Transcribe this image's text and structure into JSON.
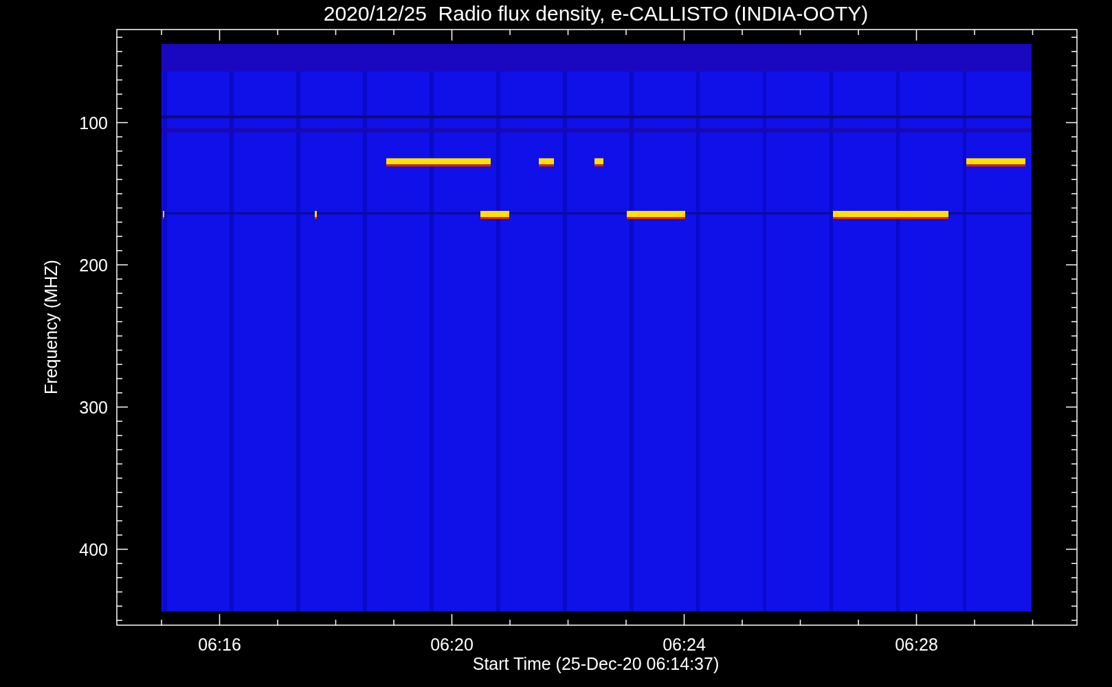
{
  "title": "2020/12/25  Radio flux density, e-CALLISTO (INDIA-OOTY)",
  "ylabel": "Frequency (MHZ)",
  "xlabel": "Start Time (25-Dec-20 06:14:37)",
  "yticks": [
    "100",
    "200",
    "300",
    "400"
  ],
  "xticks": [
    "06:16",
    "06:20",
    "06:24",
    "06:28"
  ]
}
